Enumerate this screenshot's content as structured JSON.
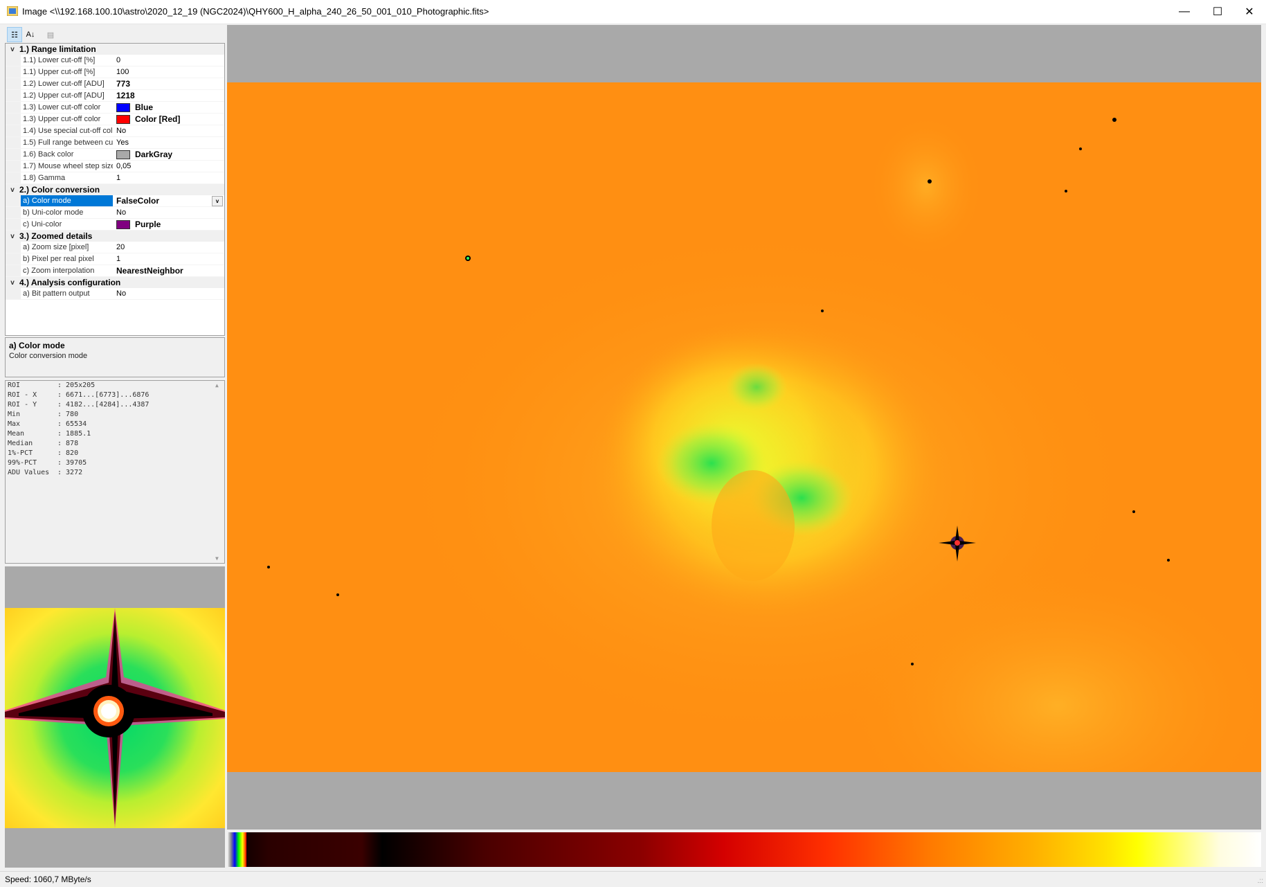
{
  "window": {
    "title": "Image <\\\\192.168.100.10\\astro\\2020_12_19 (NGC2024)\\QHY600_H_alpha_240_26_50_001_010_Photographic.fits>",
    "min_glyph": "—",
    "max_glyph": "☐",
    "close_glyph": "✕"
  },
  "toolbar": {
    "categorized_glyph": "☷",
    "alpha_glyph": "A↓",
    "pages_glyph": "▤"
  },
  "propgrid": {
    "cat1": {
      "label": "1.) Range limitation"
    },
    "p_lower_pct": {
      "name": "1.1) Lower cut-off [%]",
      "value": "0"
    },
    "p_upper_pct": {
      "name": "1.1) Upper cut-off [%]",
      "value": "100"
    },
    "p_lower_adu": {
      "name": "1.2) Lower cut-off [ADU]",
      "value": "773"
    },
    "p_upper_adu": {
      "name": "1.2) Upper cut-off [ADU]",
      "value": "1218"
    },
    "p_lower_color": {
      "name": "1.3) Lower cut-off color",
      "value": "Blue",
      "color": "#0000ff"
    },
    "p_upper_color": {
      "name": "1.3) Upper cut-off color",
      "value": "Color [Red]",
      "color": "#ff0000"
    },
    "p_special": {
      "name": "1.4) Use special cut-off col",
      "value": "No"
    },
    "p_fullrange": {
      "name": "1.5) Full range between cu",
      "value": "Yes"
    },
    "p_back": {
      "name": "1.6) Back color",
      "value": "DarkGray",
      "color": "#a9a9a9"
    },
    "p_wheel": {
      "name": "1.7) Mouse wheel step size",
      "value": "0,05"
    },
    "p_gamma": {
      "name": "1.8) Gamma",
      "value": "1"
    },
    "cat2": {
      "label": "2.) Color conversion"
    },
    "p_colormode": {
      "name": "a) Color mode",
      "value": "FalseColor"
    },
    "p_unimode": {
      "name": "b) Uni-color mode",
      "value": "No"
    },
    "p_unicolor": {
      "name": "c) Uni-color",
      "value": "Purple",
      "color": "#800080"
    },
    "cat3": {
      "label": "3.) Zoomed details"
    },
    "p_zoomsize": {
      "name": "a) Zoom size [pixel]",
      "value": "20"
    },
    "p_ppr": {
      "name": "b) Pixel per real pixel",
      "value": "1"
    },
    "p_interp": {
      "name": "c) Zoom interpolation",
      "value": "NearestNeighbor"
    },
    "cat4": {
      "label": "4.) Analysis configuration"
    },
    "p_bitpattern": {
      "name": "a) Bit pattern output",
      "value": "No"
    },
    "chevron": "v",
    "dropdown_glyph": "v"
  },
  "help": {
    "title": "a) Color mode",
    "desc": "Color conversion mode"
  },
  "stats": [
    {
      "label": "ROI",
      "value": ": 205x205"
    },
    {
      "label": "ROI - X",
      "value": ": 6671...[6773]...6876"
    },
    {
      "label": "ROI - Y",
      "value": ": 4182...[4284]...4387"
    },
    {
      "label": "Min",
      "value": ": 780"
    },
    {
      "label": "Max",
      "value": ": 65534"
    },
    {
      "label": "Mean",
      "value": ": 1885.1"
    },
    {
      "label": "Median",
      "value": ": 878"
    },
    {
      "label": "1%-PCT",
      "value": ": 820"
    },
    {
      "label": "99%-PCT",
      "value": ": 39705"
    },
    {
      "label": "ADU Values",
      "value": ": 3272"
    }
  ],
  "stats_scroll": {
    "up": "▲",
    "down": "▼"
  },
  "status": {
    "text": "Speed: 1060,7 MByte/s",
    "grip": ".::"
  },
  "colors": {
    "accent": "#0078d7",
    "image_bg": "#ff8c10",
    "nebula": "#f2e020"
  }
}
